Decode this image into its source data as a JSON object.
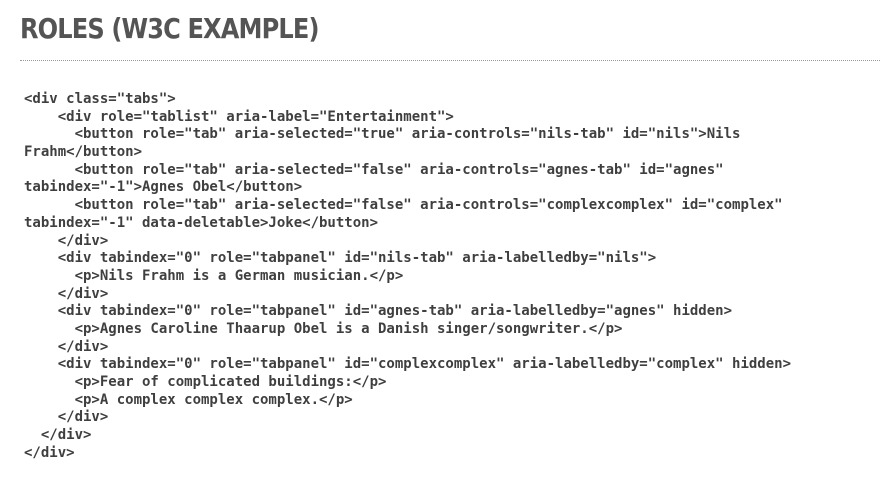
{
  "slide": {
    "title": "ROLES (W3C EXAMPLE)"
  },
  "code": {
    "lines": [
      "<div class=\"tabs\">",
      "    <div role=\"tablist\" aria-label=\"Entertainment\">",
      "      <button role=\"tab\" aria-selected=\"true\" aria-controls=\"nils-tab\" id=\"nils\">Nils",
      "Frahm</button>",
      "      <button role=\"tab\" aria-selected=\"false\" aria-controls=\"agnes-tab\" id=\"agnes\"",
      "tabindex=\"-1\">Agnes Obel</button>",
      "      <button role=\"tab\" aria-selected=\"false\" aria-controls=\"complexcomplex\" id=\"complex\"",
      "tabindex=\"-1\" data-deletable>Joke</button>",
      "    </div>",
      "    <div tabindex=\"0\" role=\"tabpanel\" id=\"nils-tab\" aria-labelledby=\"nils\">",
      "      <p>Nils Frahm is a German musician.</p>",
      "    </div>",
      "    <div tabindex=\"0\" role=\"tabpanel\" id=\"agnes-tab\" aria-labelledby=\"agnes\" hidden>",
      "      <p>Agnes Caroline Thaarup Obel is a Danish singer/songwriter.</p>",
      "    </div>",
      "    <div tabindex=\"0\" role=\"tabpanel\" id=\"complexcomplex\" aria-labelledby=\"complex\" hidden>",
      "      <p>Fear of complicated buildings:</p>",
      "      <p>A complex complex complex.</p>",
      "    </div>",
      "  </div>",
      "</div>"
    ]
  }
}
